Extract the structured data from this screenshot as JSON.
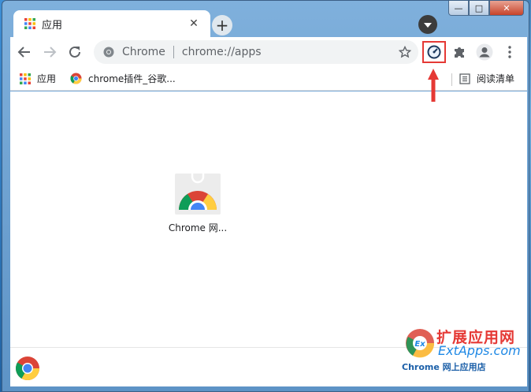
{
  "tab": {
    "title": "应用",
    "close_glyph": "✕"
  },
  "newtab_glyph": "+",
  "caption": {
    "minimize": "—",
    "maximize": "□",
    "close": "✕"
  },
  "omnibox": {
    "site_label": "Chrome",
    "url": "chrome://apps"
  },
  "bookmarks": {
    "apps_label": "应用",
    "item1_label": "chrome插件_谷歌...",
    "reading_list_label": "阅读清单"
  },
  "app_tile": {
    "label": "Chrome 网..."
  },
  "watermark": {
    "title": "扩展应用网",
    "domain": "ExtApps.com",
    "logo_text": "Ex",
    "store_label": "Chrome 网上应用店"
  },
  "colors": {
    "highlight": "#e53935",
    "accent": "#1a73e8"
  }
}
